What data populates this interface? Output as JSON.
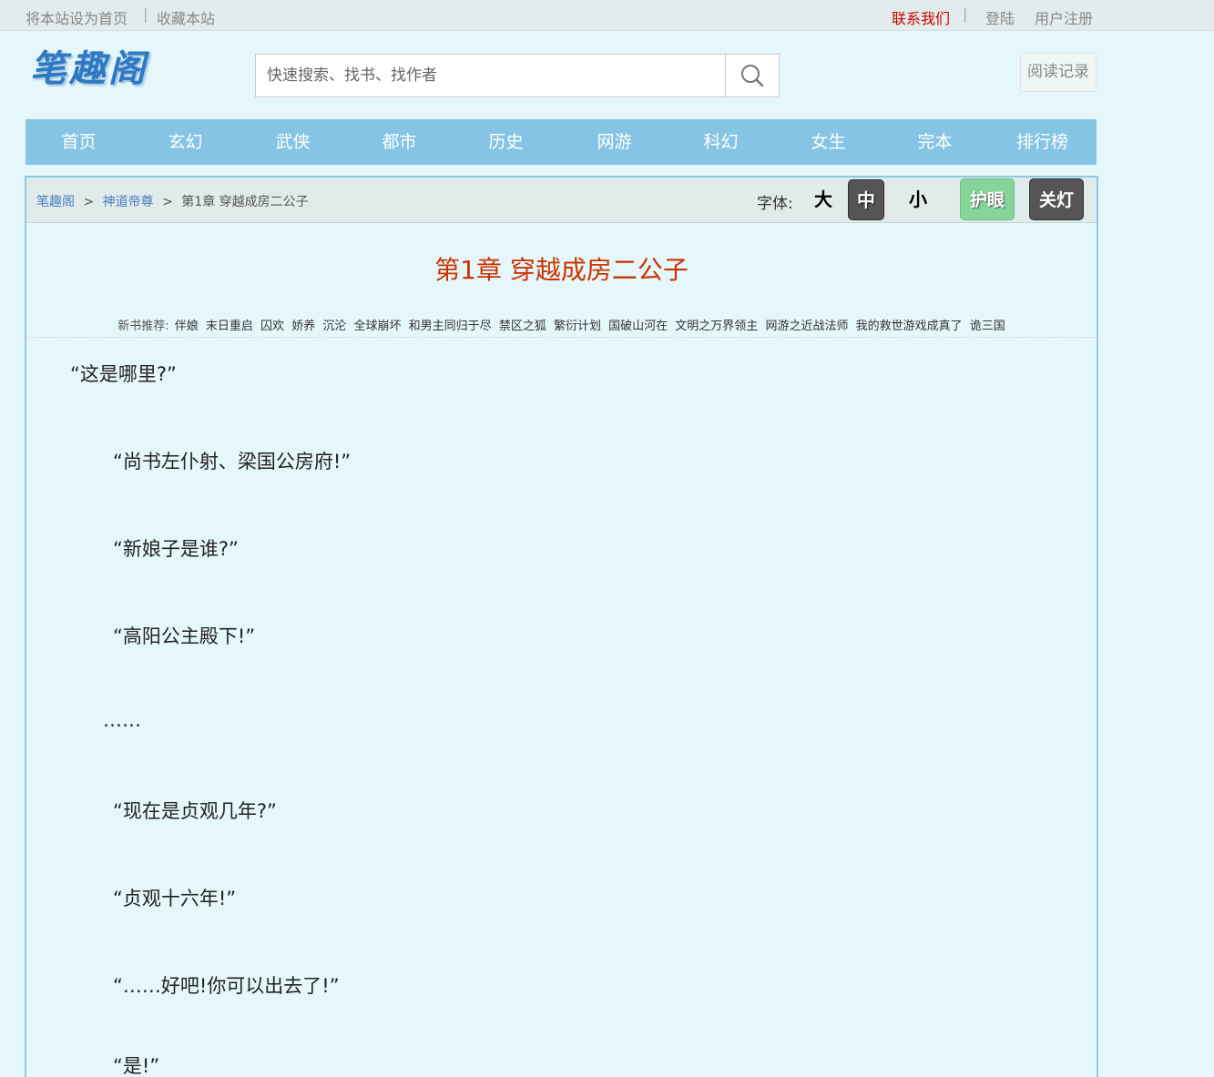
{
  "topbar": {
    "set_home": "将本站设为首页",
    "bookmark": "收藏本站",
    "contact": "联系我们",
    "login": "登陆",
    "register": "用户注册"
  },
  "logo": {
    "text": "笔趣阁"
  },
  "search": {
    "placeholder": "快速搜索、找书、找作者",
    "icon": "search-icon"
  },
  "history_label": "阅读记录",
  "nav": [
    "首页",
    "玄幻",
    "武侠",
    "都市",
    "历史",
    "网游",
    "科幻",
    "女生",
    "完本",
    "排行榜"
  ],
  "breadcrumb": {
    "site": "笔趣阁",
    "book": "神道帝尊",
    "chapter": "第1章 穿越成房二公子",
    "sep": ">"
  },
  "font_controls": {
    "label": "字体:",
    "large": "大",
    "medium": "中",
    "small": "小",
    "eye_care": "护眼",
    "lights_off": "关灯"
  },
  "chapter_title": "第1章 穿越成房二公子",
  "recommend": {
    "label": "新书推荐:",
    "books": [
      "伴娘",
      "末日重启",
      "囚欢",
      "娇养",
      "沉沦",
      "全球崩坏",
      "和男主同归于尽",
      "禁区之狐",
      "繁衍计划",
      "国破山河在",
      "文明之万界领主",
      "网游之近战法师",
      "我的救世游戏成真了",
      "诡三国"
    ]
  },
  "paragraphs": [
    "“这是哪里?”",
    "“尚书左仆射、梁国公房府!”",
    "“新娘子是谁?”",
    "“高阳公主殿下!”",
    "……",
    "“现在是贞观几年?”",
    "“贞观十六年!”",
    "“……好吧!你可以出去了!”",
    "“是!”"
  ],
  "colors": {
    "background": "#e6f7fb",
    "nav": "#85c4e4",
    "title": "#cc3300",
    "contact": "#d40000",
    "eye_care_btn": "#87d49a"
  }
}
